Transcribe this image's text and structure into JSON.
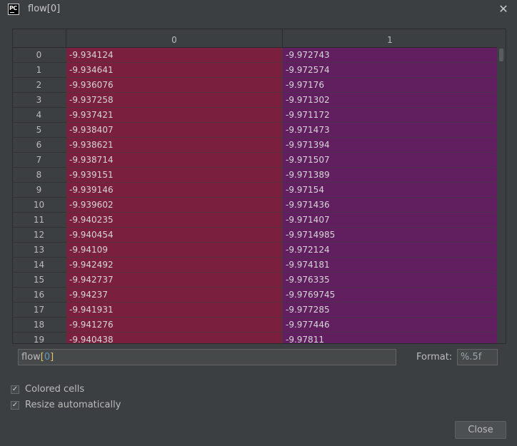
{
  "window": {
    "title": "flow[0]",
    "app_icon": "PC",
    "close_glyph": "✕"
  },
  "table": {
    "columns": [
      "0",
      "1"
    ],
    "rows": [
      {
        "index": "0",
        "c0": "-9.934124",
        "c1": "-9.972743"
      },
      {
        "index": "1",
        "c0": "-9.934641",
        "c1": "-9.972574"
      },
      {
        "index": "2",
        "c0": "-9.936076",
        "c1": "-9.97176"
      },
      {
        "index": "3",
        "c0": "-9.937258",
        "c1": "-9.971302"
      },
      {
        "index": "4",
        "c0": "-9.937421",
        "c1": "-9.971172"
      },
      {
        "index": "5",
        "c0": "-9.938407",
        "c1": "-9.971473"
      },
      {
        "index": "6",
        "c0": "-9.938621",
        "c1": "-9.971394"
      },
      {
        "index": "7",
        "c0": "-9.938714",
        "c1": "-9.971507"
      },
      {
        "index": "8",
        "c0": "-9.939151",
        "c1": "-9.971389"
      },
      {
        "index": "9",
        "c0": "-9.939146",
        "c1": "-9.97154"
      },
      {
        "index": "10",
        "c0": "-9.939602",
        "c1": "-9.971436"
      },
      {
        "index": "11",
        "c0": "-9.940235",
        "c1": "-9.971407"
      },
      {
        "index": "12",
        "c0": "-9.940454",
        "c1": "-9.9714985"
      },
      {
        "index": "13",
        "c0": "-9.94109",
        "c1": "-9.972124"
      },
      {
        "index": "14",
        "c0": "-9.942492",
        "c1": "-9.974181"
      },
      {
        "index": "15",
        "c0": "-9.942737",
        "c1": "-9.976335"
      },
      {
        "index": "16",
        "c0": "-9.94237",
        "c1": "-9.9769745"
      },
      {
        "index": "17",
        "c0": "-9.941931",
        "c1": "-9.977285"
      },
      {
        "index": "18",
        "c0": "-9.941276",
        "c1": "-9.977446"
      },
      {
        "index": "19",
        "c0": "-9.940438",
        "c1": "-9.97811"
      }
    ],
    "colors": {
      "col0": "#7a1f3d",
      "col1": "#611f60"
    }
  },
  "expression": {
    "name": "flow",
    "open": "[",
    "index": "0",
    "close": "]"
  },
  "format": {
    "label": "Format:",
    "value": "%.5f"
  },
  "options": [
    {
      "label": "Colored cells",
      "checked": true
    },
    {
      "label": "Resize automatically",
      "checked": true
    }
  ],
  "buttons": {
    "close": "Close"
  }
}
